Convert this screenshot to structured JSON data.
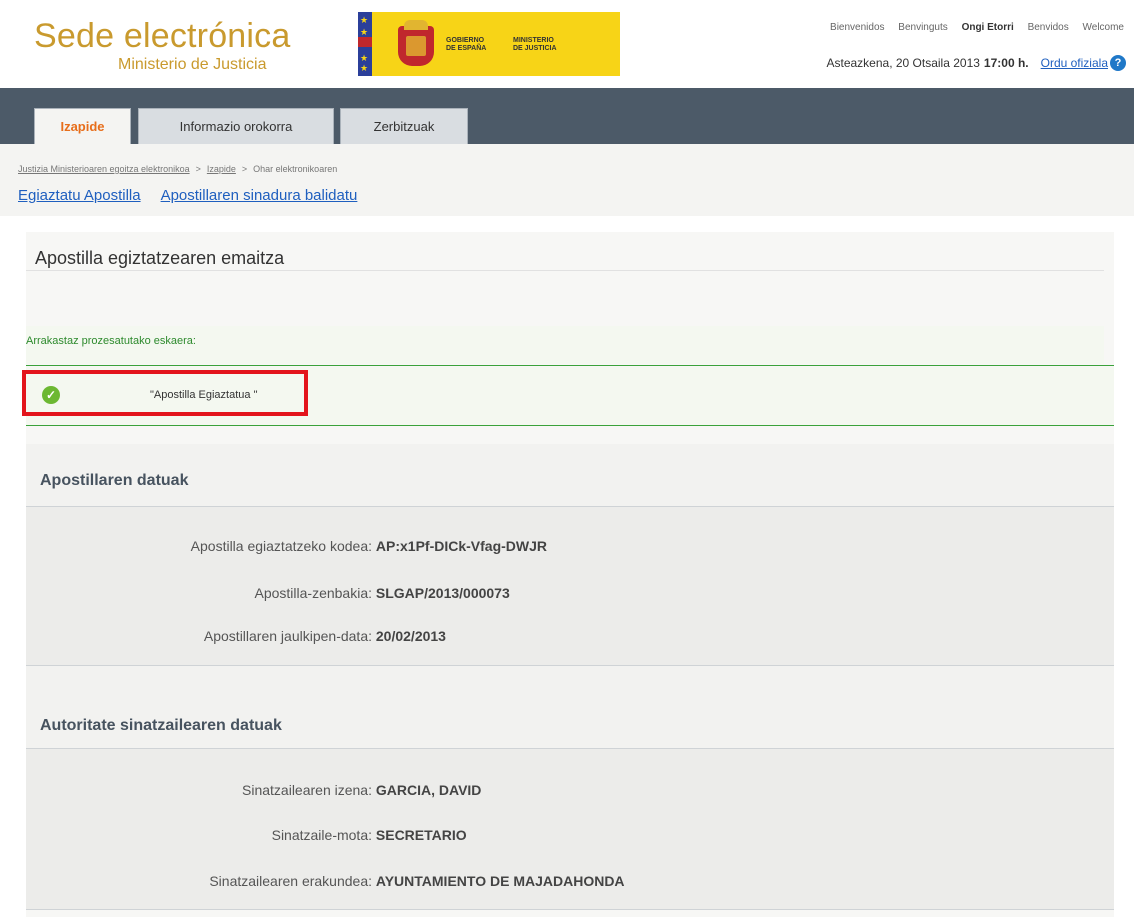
{
  "header": {
    "site_title": "Sede electrónica",
    "site_subtitle": "Ministerio de Justicia",
    "gov_text": "GOBIERNO\nDE ESPAÑA",
    "ministry_text": "MINISTERIO\nDE JUSTICIA",
    "languages": [
      {
        "label": "Bienvenidos",
        "active": false
      },
      {
        "label": "Benvinguts",
        "active": false
      },
      {
        "label": "Ongi Etorri",
        "active": true
      },
      {
        "label": "Benvidos",
        "active": false
      },
      {
        "label": "Welcome",
        "active": false
      }
    ],
    "date_text": "Asteazkena, 20 Otsaila 2013",
    "time_text": "17:00 h.",
    "official_time_link": "Ordu ofiziala",
    "help_icon": "?"
  },
  "nav": {
    "tabs": [
      {
        "label": "Izapide",
        "active": true
      },
      {
        "label": "Informazio orokorra",
        "active": false
      },
      {
        "label": "Zerbitzuak",
        "active": false
      }
    ]
  },
  "breadcrumb": {
    "items": [
      "Justizia Ministerioaren egoitza elektronikoa",
      "Izapide",
      "Ohar elektronikoaren"
    ],
    "separator": ">"
  },
  "sublinks": [
    "Egiaztatu Apostilla",
    "Apostillaren sinadura balidatu"
  ],
  "main": {
    "title": "Apostilla egiztatzearen emaitza",
    "success_heading": "Arrakastaz prozesatutako eskaera:",
    "result_text": "\"Apostilla Egiaztatua \"",
    "sections": [
      {
        "title": "Apostillaren datuak",
        "rows": [
          {
            "label": "Apostilla egiaztatzeko kodea:",
            "value": "AP:x1Pf-DICk-Vfag-DWJR"
          },
          {
            "label": "Apostilla-zenbakia:",
            "value": "SLGAP/2013/000073"
          },
          {
            "label": "Apostillaren jaulkipen-data:",
            "value": "20/02/2013"
          }
        ]
      },
      {
        "title": "Autoritate sinatzailearen datuak",
        "rows": [
          {
            "label": "Sinatzailearen izena:",
            "value": "GARCIA, DAVID"
          },
          {
            "label": "Sinatzaile-mota:",
            "value": "SECRETARIO"
          },
          {
            "label": "Sinatzailearen erakundea:",
            "value": "AYUNTAMIENTO DE MAJADAHONDA"
          }
        ]
      }
    ]
  },
  "colors": {
    "brand_gold": "#c99a2e",
    "nav_band": "#4c5a68",
    "active_tab_text": "#e76e1b",
    "link": "#1f5fbf",
    "success_green": "#3aa23a",
    "highlight_red": "#e3151c"
  }
}
